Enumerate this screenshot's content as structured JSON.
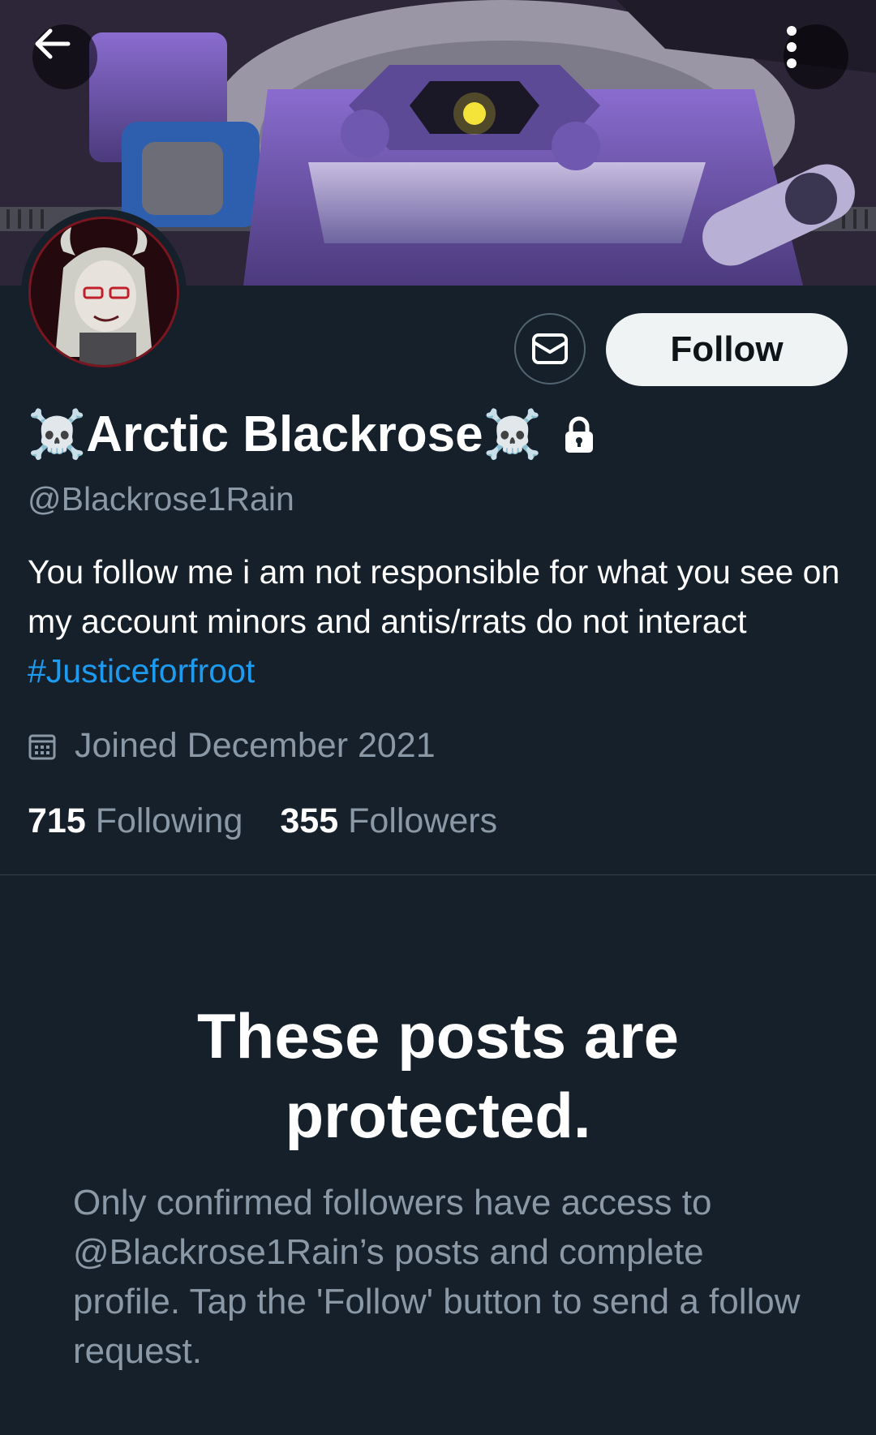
{
  "header": {
    "back_icon": "arrow-left-icon",
    "more_icon": "more-vertical-icon"
  },
  "profile": {
    "skull_left": "☠️",
    "name": "Arctic Blackrose",
    "skull_right": "☠️",
    "handle": "@Blackrose1Rain",
    "bio_text": "You follow me i am not responsible for what you see on my account minors and antis/rrats do not interact ",
    "bio_hashtag": "#Justiceforfroot",
    "joined": "Joined December 2021",
    "following_count": "715",
    "following_label": "Following",
    "followers_count": "355",
    "followers_label": "Followers"
  },
  "actions": {
    "follow_label": "Follow",
    "message_icon": "envelope-icon"
  },
  "protected": {
    "title": "These posts are protected.",
    "description": "Only confirmed followers have access to @Blackrose1Rain’s posts and complete profile. Tap the 'Follow' button to send a follow request."
  },
  "colors": {
    "background": "#15202b",
    "accent": "#1d9bf0",
    "muted_text": "#8b98a5",
    "follow_button_bg": "#eff3f4"
  }
}
